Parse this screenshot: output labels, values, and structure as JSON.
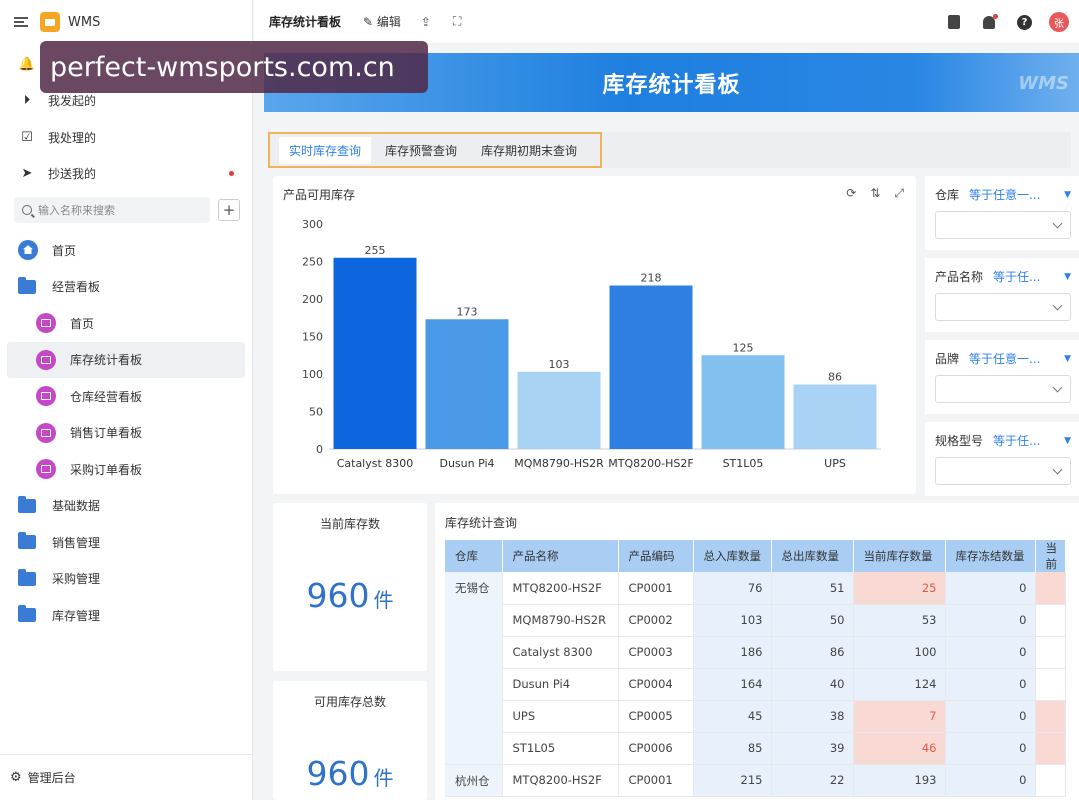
{
  "app": {
    "name": "WMS"
  },
  "sidebar": {
    "top_items": [
      {
        "label": "我发起的",
        "icon": "play-icon"
      },
      {
        "label": "我处理的",
        "icon": "check-box-icon"
      },
      {
        "label": "抄送我的",
        "icon": "send-icon"
      }
    ],
    "search_placeholder": "输入名称来搜索",
    "tree": {
      "home": "首页",
      "group1": "经营看板",
      "sub": [
        "首页",
        "库存统计看板",
        "仓库经营看板",
        "销售订单看板",
        "采购订单看板"
      ],
      "folders": [
        "基础数据",
        "销售管理",
        "采购管理",
        "库存管理"
      ]
    },
    "admin_label": "管理后台"
  },
  "topbar": {
    "title": "库存统计看板",
    "edit_label": "编辑",
    "avatar_text": "张"
  },
  "banner": {
    "title": "库存统计看板",
    "watermark": "WMS"
  },
  "overlay": {
    "text": "perfect-wmsports.com.cn"
  },
  "tabs": [
    "实时库存查询",
    "库存预警查询",
    "库存期初期末查询"
  ],
  "chart_card": {
    "title": "产品可用库存"
  },
  "chart_data": {
    "type": "bar",
    "categories": [
      "Catalyst 8300",
      "Dusun Pi4",
      "MQM8790-HS2R",
      "MTQ8200-HS2F",
      "ST1L05",
      "UPS"
    ],
    "values": [
      255,
      173,
      103,
      218,
      125,
      86
    ],
    "ylim": [
      0,
      300
    ],
    "yticks": [
      0,
      50,
      100,
      150,
      200,
      250,
      300
    ],
    "colors": [
      "#0d66dd",
      "#4a9ae8",
      "#a9d3f5",
      "#2f7fe3",
      "#82c0f0",
      "#a9d3f5"
    ],
    "grid": false,
    "title": "产品可用库存"
  },
  "filters": [
    {
      "label": "仓库",
      "op": "等于任意一..."
    },
    {
      "label": "产品名称",
      "op": "等于任..."
    },
    {
      "label": "品牌",
      "op": "等于任意一..."
    },
    {
      "label": "规格型号",
      "op": "等于任..."
    }
  ],
  "kpis": [
    {
      "label": "当前库存数",
      "value": "960",
      "unit": "件"
    },
    {
      "label": "可用库存总数",
      "value": "960",
      "unit": "件"
    }
  ],
  "table": {
    "title": "库存统计查询",
    "columns": [
      "仓库",
      "产品名称",
      "产品编码",
      "总入库数量",
      "总出库数量",
      "当前库存数量",
      "库存冻结数量",
      "当前"
    ],
    "groups": [
      {
        "warehouse": "无锡仓",
        "rows": [
          {
            "name": "MTQ8200-HS2F",
            "code": "CP0001",
            "in": "76",
            "out": "51",
            "cur": "25",
            "frozen": "0",
            "cur_low": true
          },
          {
            "name": "MQM8790-HS2R",
            "code": "CP0002",
            "in": "103",
            "out": "50",
            "cur": "53",
            "frozen": "0",
            "cur_low": false
          },
          {
            "name": "Catalyst 8300",
            "code": "CP0003",
            "in": "186",
            "out": "86",
            "cur": "100",
            "frozen": "0",
            "cur_low": false
          },
          {
            "name": "Dusun Pi4",
            "code": "CP0004",
            "in": "164",
            "out": "40",
            "cur": "124",
            "frozen": "0",
            "cur_low": false
          },
          {
            "name": "UPS",
            "code": "CP0005",
            "in": "45",
            "out": "38",
            "cur": "7",
            "frozen": "0",
            "cur_low": true
          },
          {
            "name": "ST1L05",
            "code": "CP0006",
            "in": "85",
            "out": "39",
            "cur": "46",
            "frozen": "0",
            "cur_low": true
          }
        ]
      },
      {
        "warehouse": "杭州仓",
        "rows": [
          {
            "name": "MTQ8200-HS2F",
            "code": "CP0001",
            "in": "215",
            "out": "22",
            "cur": "193",
            "frozen": "0",
            "cur_low": false
          }
        ]
      }
    ]
  }
}
